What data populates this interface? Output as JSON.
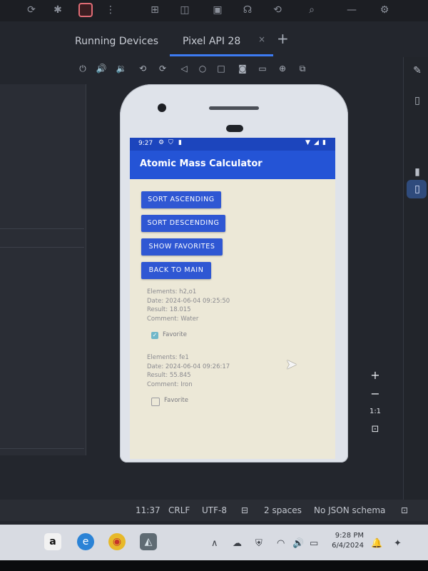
{
  "ide": {
    "tabs": [
      {
        "label": "Running Devices"
      },
      {
        "label": "Pixel API 28"
      }
    ],
    "tab_close": "×",
    "tab_add": "+"
  },
  "phone": {
    "status_time": "9:27",
    "app_title": "Atomic Mass Calculator",
    "buttons": [
      {
        "label": "SORT ASCENDING"
      },
      {
        "label": "SORT DESCENDING"
      },
      {
        "label": "SHOW FAVORITES"
      },
      {
        "label": "BACK TO MAIN"
      }
    ],
    "records": [
      {
        "elements": "Elements: h2,o1",
        "date": "Date: 2024-06-04 09:25:50",
        "result": "Result: 18.015",
        "comment": "Comment: Water",
        "favorite_label": "Favorite",
        "favorite": true
      },
      {
        "elements": "Elements: fe1",
        "date": "Date: 2024-06-04 09:26:17",
        "result": "Result: 55.845",
        "comment": "Comment: Iron",
        "favorite_label": "Favorite",
        "favorite": false
      }
    ]
  },
  "zoom": {
    "plus": "+",
    "minus": "−",
    "one_to_one": "1:1"
  },
  "statusbar": {
    "position": "11:37",
    "line_sep": "CRLF",
    "encoding": "UTF-8",
    "indent": "2 spaces",
    "schema": "No JSON schema"
  },
  "taskbar": {
    "time": "9:28 PM",
    "date": "6/4/2024"
  },
  "colors": {
    "app_bar": "#2454d6",
    "status_bar": "#1c45bd",
    "button": "#2f57d3",
    "active_tab": "#3d7bf3"
  }
}
